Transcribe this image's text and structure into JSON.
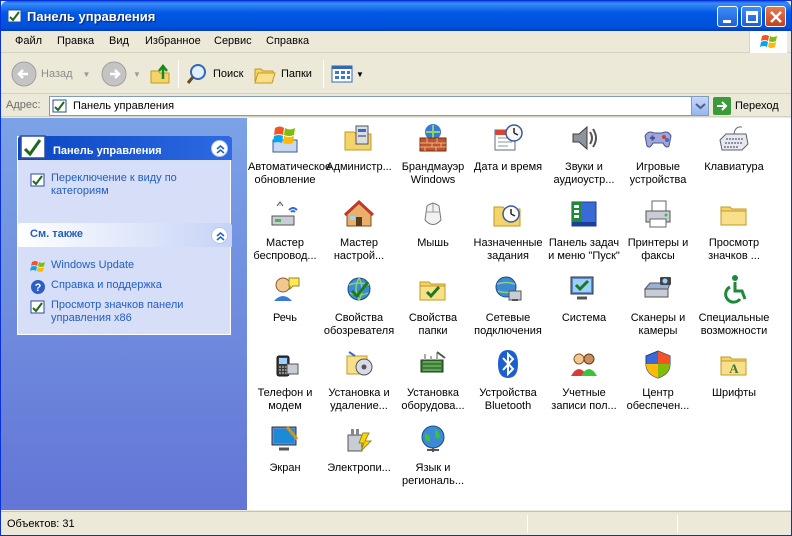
{
  "window": {
    "title": "Панель управления"
  },
  "menu": [
    "Файл",
    "Правка",
    "Вид",
    "Избранное",
    "Сервис",
    "Справка"
  ],
  "toolbar": {
    "back": "Назад",
    "search": "Поиск",
    "folders": "Папки"
  },
  "address": {
    "label": "Адрес:",
    "value": "Панель управления",
    "go": "Переход"
  },
  "tasks_panel": {
    "title": "Панель управления",
    "link": "Переключение к виду по категориям"
  },
  "see_also": {
    "title": "См. также",
    "links": [
      "Windows Update",
      "Справка и поддержка",
      "Просмотр значков панели управления x86"
    ]
  },
  "items": [
    {
      "label": "Автоматическое обновление",
      "icon": "automatic-updates-icon"
    },
    {
      "label": "Администр...",
      "icon": "administrative-tools-icon"
    },
    {
      "label": "Брандмауэр Windows",
      "icon": "firewall-icon"
    },
    {
      "label": "Дата и время",
      "icon": "date-time-icon"
    },
    {
      "label": "Звуки и аудиоустр...",
      "icon": "sounds-icon"
    },
    {
      "label": "Игровые устройства",
      "icon": "game-controllers-icon"
    },
    {
      "label": "Клавиатура",
      "icon": "keyboard-icon"
    },
    {
      "label": "Мастер беспровод...",
      "icon": "wireless-wizard-icon"
    },
    {
      "label": "Мастер настрой...",
      "icon": "network-setup-icon"
    },
    {
      "label": "Мышь",
      "icon": "mouse-icon"
    },
    {
      "label": "Назначенные задания",
      "icon": "scheduled-tasks-icon"
    },
    {
      "label": "Панель задач и меню \"Пуск\"",
      "icon": "taskbar-icon"
    },
    {
      "label": "Принтеры и факсы",
      "icon": "printers-icon"
    },
    {
      "label": "Просмотр значков ...",
      "icon": "folder-icon"
    },
    {
      "label": "Речь",
      "icon": "speech-icon"
    },
    {
      "label": "Свойства обозревателя",
      "icon": "internet-options-icon"
    },
    {
      "label": "Свойства папки",
      "icon": "folder-options-icon"
    },
    {
      "label": "Сетевые подключения",
      "icon": "network-connections-icon"
    },
    {
      "label": "Система",
      "icon": "system-icon"
    },
    {
      "label": "Сканеры и камеры",
      "icon": "scanners-icon"
    },
    {
      "label": "Специальные возможности",
      "icon": "accessibility-icon"
    },
    {
      "label": "Телефон и модем",
      "icon": "phone-modem-icon"
    },
    {
      "label": "Установка и удаление...",
      "icon": "add-remove-programs-icon"
    },
    {
      "label": "Установка оборудова...",
      "icon": "add-hardware-icon"
    },
    {
      "label": "Устройства Bluetooth",
      "icon": "bluetooth-icon"
    },
    {
      "label": "Учетные записи пол...",
      "icon": "user-accounts-icon"
    },
    {
      "label": "Центр обеспечен...",
      "icon": "security-center-icon"
    },
    {
      "label": "Шрифты",
      "icon": "fonts-icon"
    },
    {
      "label": "Экран",
      "icon": "display-icon"
    },
    {
      "label": "Электропи...",
      "icon": "power-options-icon"
    },
    {
      "label": "Язык и региональ...",
      "icon": "regional-options-icon"
    }
  ],
  "status": {
    "text": "Объектов: 31"
  }
}
